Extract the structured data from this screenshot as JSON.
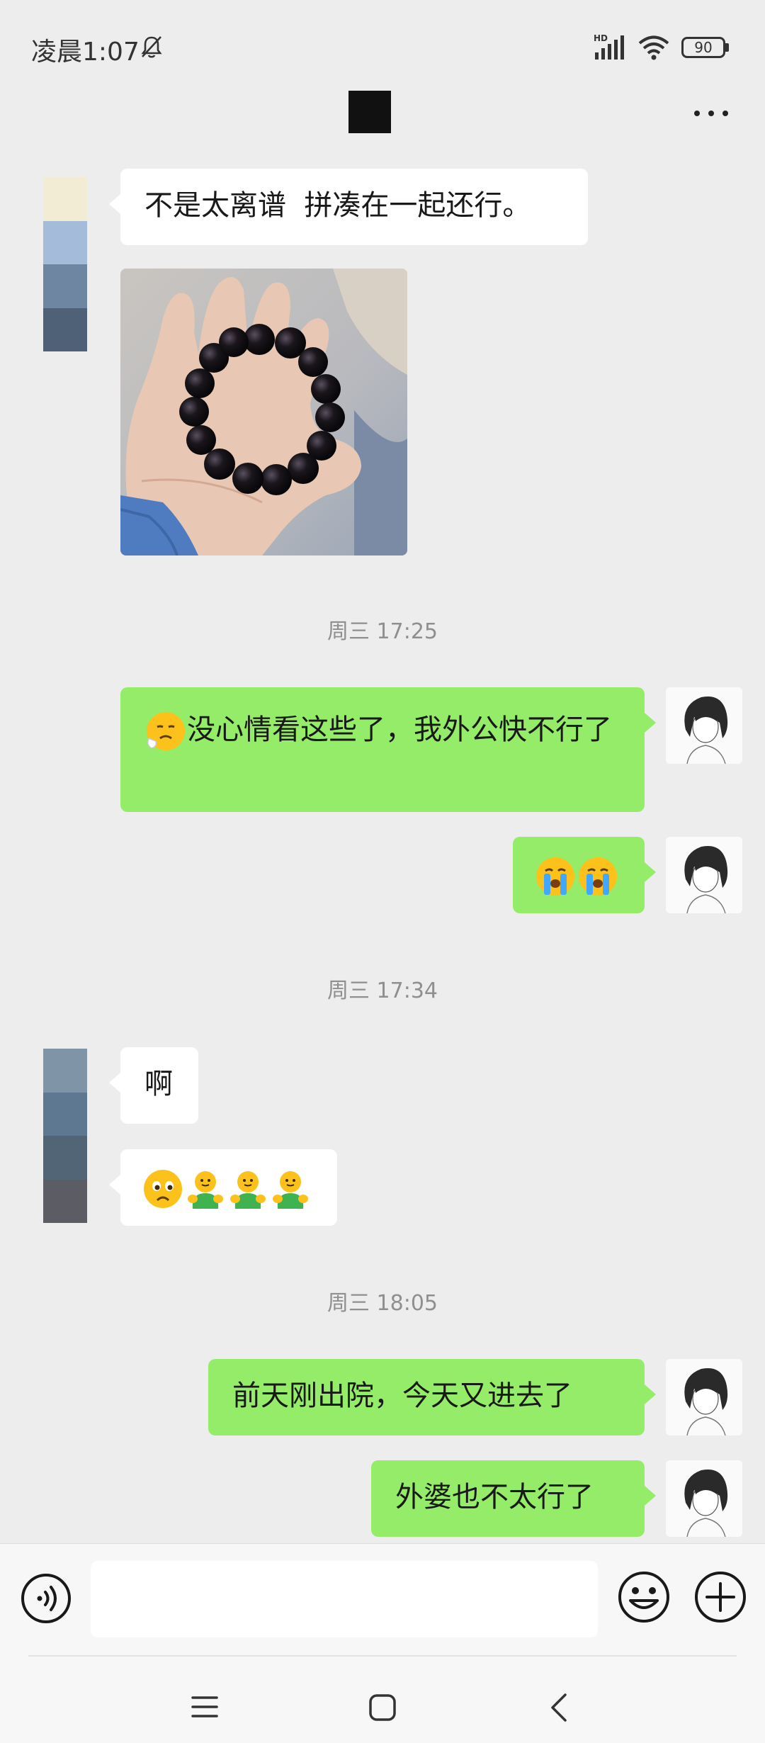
{
  "status_bar": {
    "time": "凌晨1:07",
    "network_label": "HD",
    "battery": "90"
  },
  "chat": {
    "title_redacted": true,
    "messages": [
      {
        "side": "in",
        "type": "text",
        "text": "不是太离谱  拼凑在一起还行。"
      },
      {
        "side": "in",
        "type": "image",
        "description_icon": "photo-bracelet"
      },
      {
        "side": "time",
        "text": "周三 17:25"
      },
      {
        "side": "out",
        "type": "text",
        "emoji": "sad-sweat-emoji",
        "text": "没心情看这些了，我外公快不行了"
      },
      {
        "side": "out",
        "type": "emoji",
        "emojis": [
          "crying-emoji",
          "crying-emoji"
        ]
      },
      {
        "side": "time",
        "text": "周三 17:34"
      },
      {
        "side": "in",
        "type": "text",
        "text": "啊"
      },
      {
        "side": "in",
        "type": "emoji",
        "emojis": [
          "frown-emoji",
          "hug-emoji",
          "hug-emoji",
          "hug-emoji"
        ]
      },
      {
        "side": "time",
        "text": "周三 18:05"
      },
      {
        "side": "out",
        "type": "text",
        "text": "前天刚出院，今天又进去了"
      },
      {
        "side": "out",
        "type": "text",
        "text": "外婆也不太行了"
      }
    ]
  },
  "colors": {
    "background": "#ededed",
    "bubble_in": "#ffffff",
    "bubble_out": "#95ec69",
    "timestamp": "#8f8f8f",
    "avatar_left_1": [
      "#f1ecd3",
      "#a4bcd9",
      "#6e86a1",
      "#4f6176"
    ],
    "avatar_left_2": [
      "#8094a8",
      "#5f7891",
      "#526577",
      "#5c5c65"
    ]
  },
  "input_bar": {
    "placeholder": ""
  }
}
